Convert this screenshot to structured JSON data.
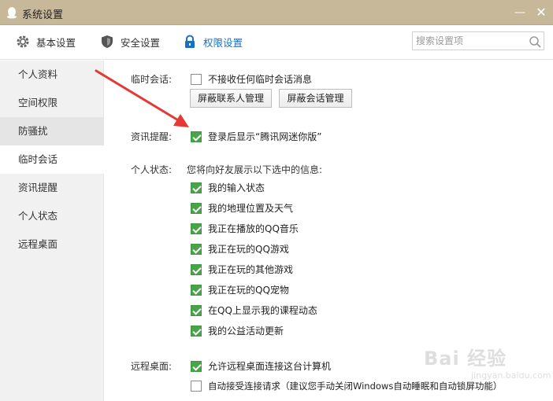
{
  "window": {
    "title": "系统设置"
  },
  "tabs": [
    {
      "label": "基本设置",
      "icon": "gear-icon"
    },
    {
      "label": "安全设置",
      "icon": "shield-icon"
    },
    {
      "label": "权限设置",
      "icon": "lock-icon"
    }
  ],
  "search": {
    "placeholder": "搜索设置项"
  },
  "sidebar": {
    "items": [
      {
        "label": "个人资料"
      },
      {
        "label": "空间权限"
      },
      {
        "label": "防骚扰"
      },
      {
        "label": "临时会话"
      },
      {
        "label": "资讯提醒"
      },
      {
        "label": "个人状态"
      },
      {
        "label": "远程桌面"
      }
    ]
  },
  "temp_chat": {
    "label": "临时会话:",
    "option": {
      "text": "不接收任何临时会话消息",
      "checked": false
    },
    "buttons": [
      "屏蔽联系人管理",
      "屏蔽会话管理"
    ]
  },
  "news": {
    "label": "资讯提醒:",
    "option": {
      "text": "登录后显示“腾讯网迷你版”",
      "checked": true
    }
  },
  "status": {
    "label": "个人状态:",
    "desc": "您将向好友展示以下选中的信息:",
    "options": [
      {
        "text": "我的输入状态",
        "checked": true
      },
      {
        "text": "我的地理位置及天气",
        "checked": true
      },
      {
        "text": "我正在播放的QQ音乐",
        "checked": true
      },
      {
        "text": "我正在玩的QQ游戏",
        "checked": true
      },
      {
        "text": "我正在玩的其他游戏",
        "checked": true
      },
      {
        "text": "我正在玩的QQ宠物",
        "checked": true
      },
      {
        "text": "在QQ上显示我的课程动态",
        "checked": true
      },
      {
        "text": "我的公益活动更新",
        "checked": true
      }
    ]
  },
  "remote": {
    "label": "远程桌面:",
    "options": [
      {
        "text": "允许远程桌面连接这台计算机",
        "checked": true
      },
      {
        "text": "自动接受连接请求（建议您手动关闭Windows自动睡眠和自动锁屏功能）",
        "checked": false
      }
    ]
  },
  "watermark": {
    "text": "Bai 经验",
    "sub": "jingyan.baidu.com"
  },
  "colors": {
    "accent": "#1b6fbf",
    "check": "#4aa34a",
    "titlebar": "#c8b89a",
    "arrow": "#e53935"
  }
}
